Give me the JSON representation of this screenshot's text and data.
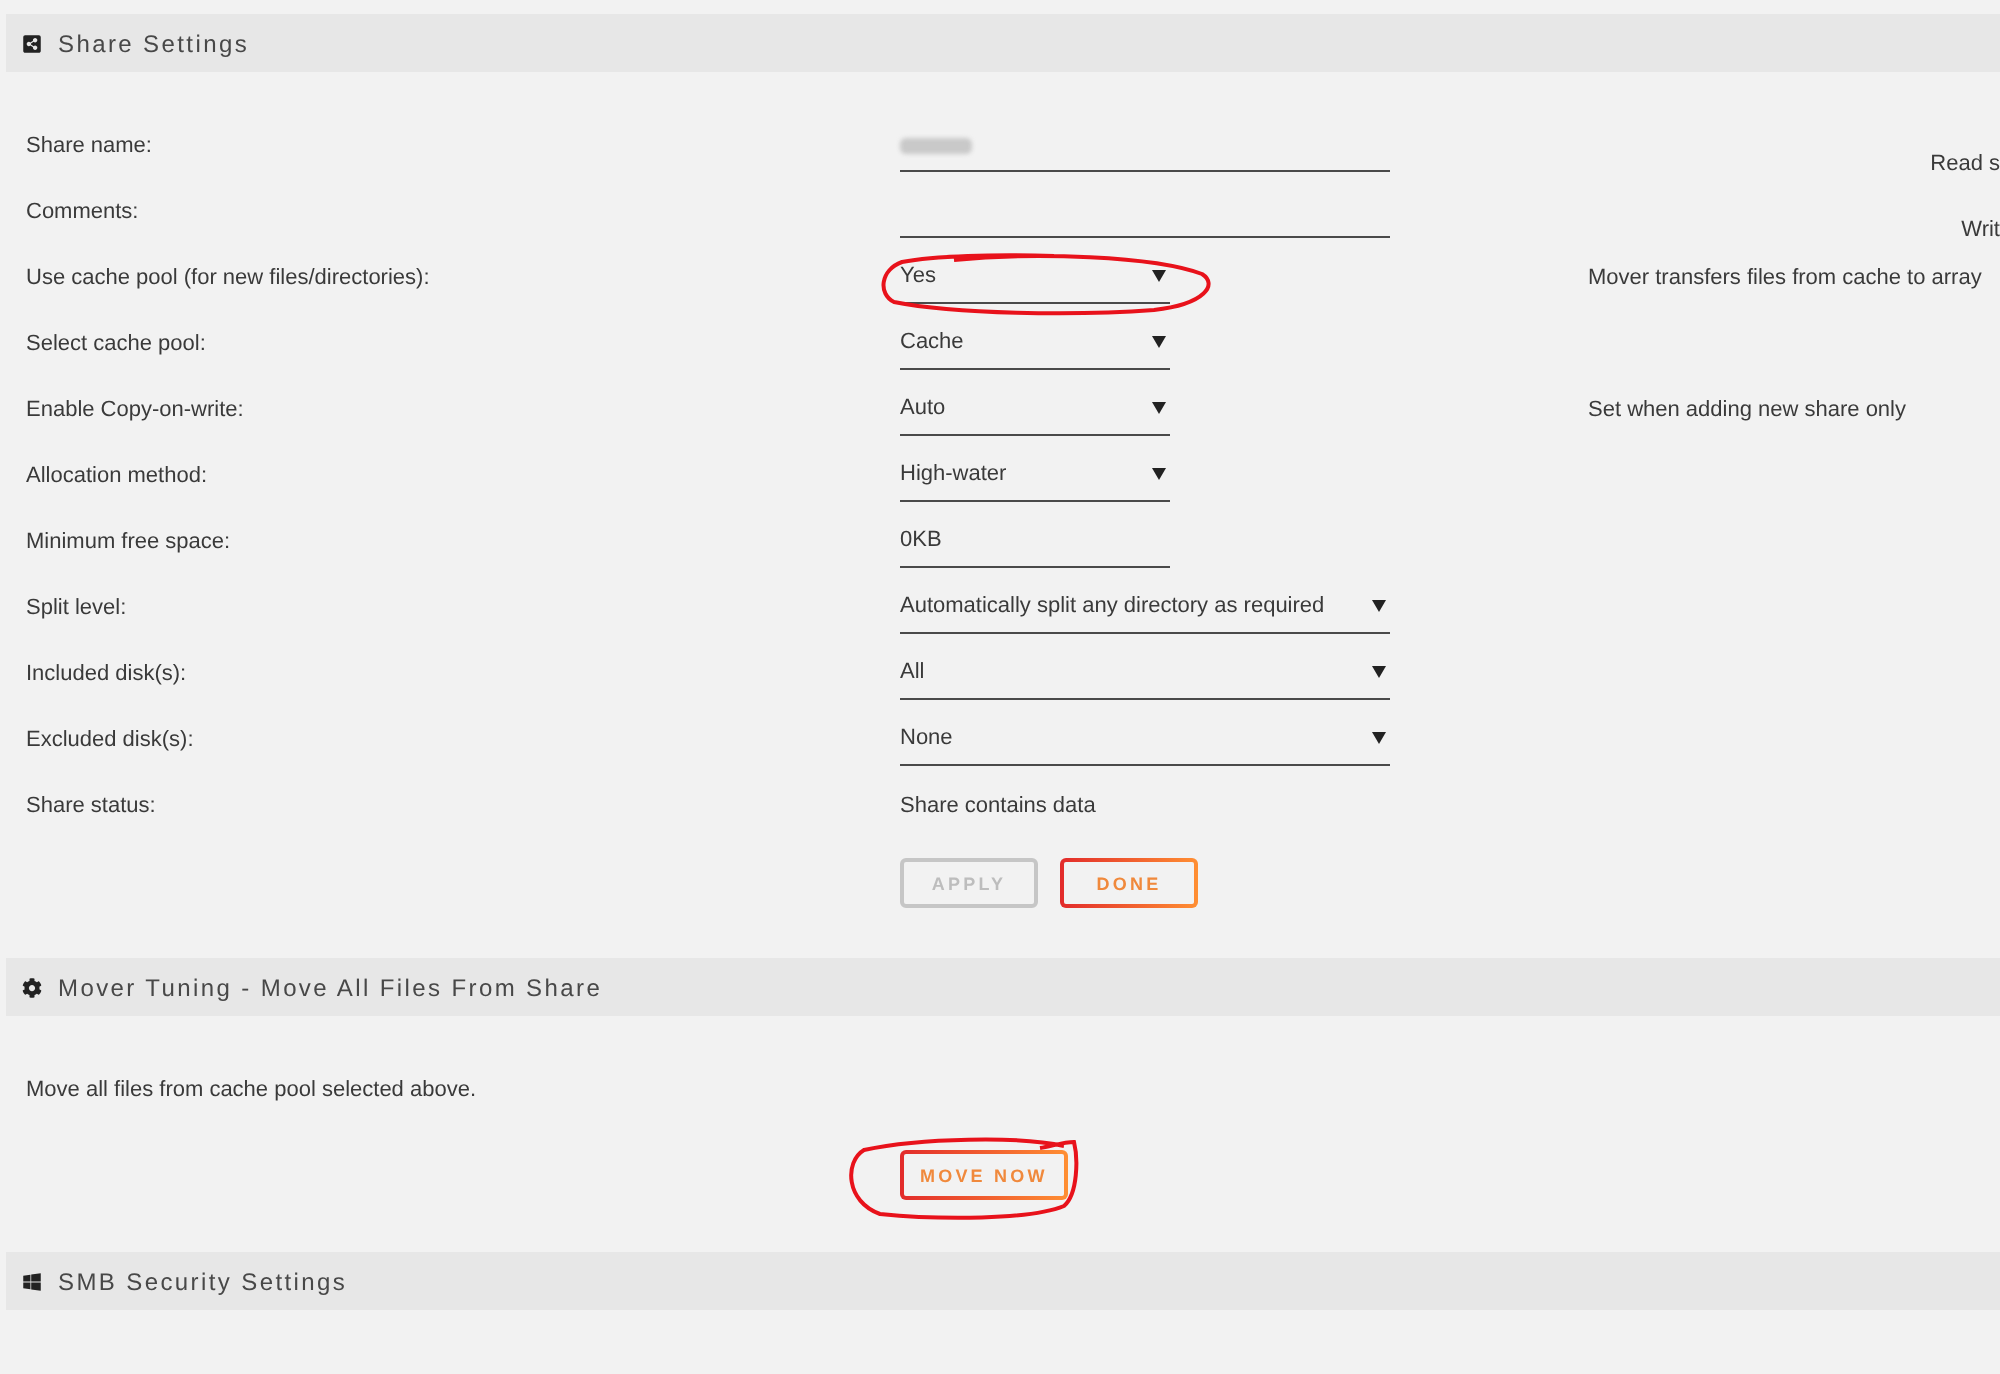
{
  "sections": [
    {
      "title": "Share Settings",
      "rows": [
        {
          "label": "Share name:",
          "kind": "text",
          "blurred": true,
          "side_note": "Read s",
          "circled": false
        },
        {
          "label": "Comments:",
          "kind": "text",
          "blurred": false,
          "side_note": "Writ",
          "circled": false
        },
        {
          "label": "Use cache pool (for new files/directories):",
          "kind": "select",
          "value": "Yes",
          "blurred": false,
          "note": "Mover transfers files from cache to array",
          "circled": true
        },
        {
          "label": "Select cache pool:",
          "kind": "select",
          "value": "Cache",
          "blurred": false,
          "circled": false
        },
        {
          "label": "Enable Copy-on-write:",
          "kind": "select",
          "value": "Auto",
          "blurred": false,
          "note": "Set when adding new share only",
          "circled": false
        },
        {
          "label": "Allocation method:",
          "kind": "select",
          "value": "High-water",
          "blurred": false,
          "circled": false
        },
        {
          "label": "Minimum free space:",
          "kind": "text",
          "value": "0KB",
          "blurred": false,
          "circled": false
        },
        {
          "label": "Split level:",
          "kind": "select",
          "value": "Automatically split any directory as required",
          "blurred": false,
          "circled": false
        },
        {
          "label": "Included disk(s):",
          "kind": "select",
          "value": "All",
          "blurred": false,
          "circled": false
        },
        {
          "label": "Excluded disk(s):",
          "kind": "select",
          "value": "None",
          "blurred": false,
          "circled": false
        },
        {
          "label": "Share status:",
          "kind": "static",
          "value": "Share contains data",
          "blurred": false,
          "circled": false
        }
      ],
      "buttons": [
        {
          "label": "APPLY",
          "disabled": true,
          "circled": false
        },
        {
          "label": "DONE",
          "disabled": false,
          "circled": false
        }
      ]
    },
    {
      "title": "Mover Tuning - Move All Files From Share",
      "text": "Move all files from cache pool selected above.",
      "buttons": [
        {
          "label": "MOVE NOW",
          "disabled": false,
          "circled": true
        }
      ]
    },
    {
      "title": "SMB Security Settings"
    }
  ]
}
